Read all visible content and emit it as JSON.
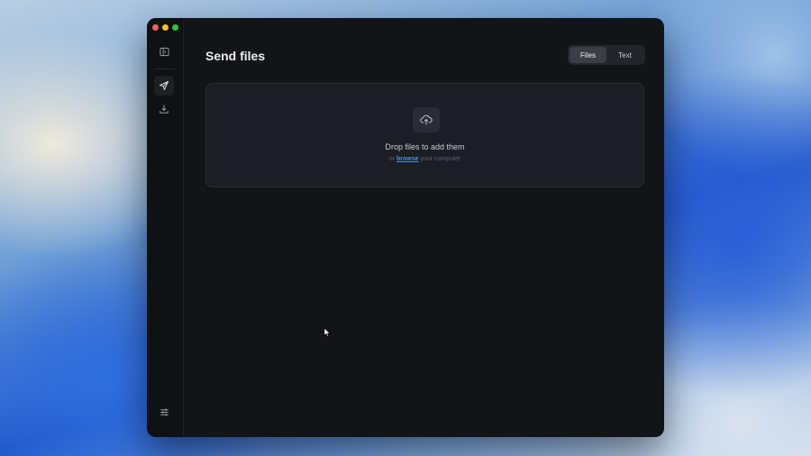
{
  "window": {
    "traffic_lights": [
      "close",
      "minimize",
      "zoom"
    ]
  },
  "sidebar": {
    "items": [
      {
        "name": "sidebar-toggle",
        "icon": "sidebar-icon"
      },
      {
        "name": "send",
        "icon": "send-icon",
        "active": true
      },
      {
        "name": "receive",
        "icon": "download-icon"
      }
    ],
    "footer_icon": "sliders-icon"
  },
  "header": {
    "title": "Send files",
    "tabs": [
      {
        "label": "Files",
        "active": true
      },
      {
        "label": "Text",
        "active": false
      }
    ]
  },
  "dropzone": {
    "icon": "cloud-upload-icon",
    "title": "Drop files to add them",
    "sub_prefix": "or",
    "browse_label": "browse",
    "sub_suffix": "your computer"
  },
  "colors": {
    "window_bg": "#121417",
    "accent_link": "#4a8ff0"
  }
}
